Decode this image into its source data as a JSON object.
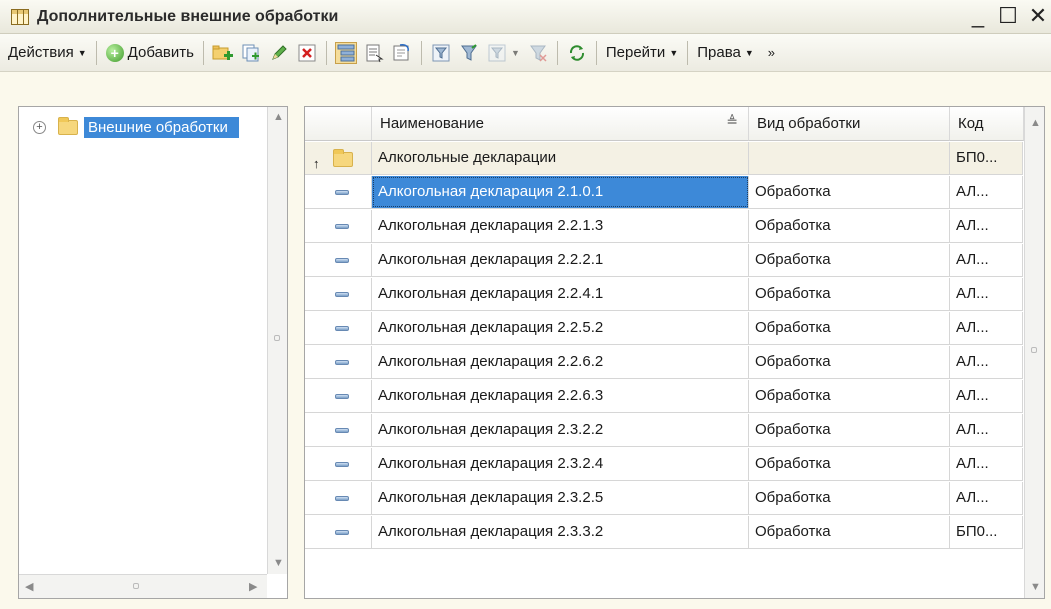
{
  "window": {
    "title": "Дополнительные внешние обработки",
    "minimize_glyph": "_",
    "maximize_glyph": "☐",
    "close_glyph": "✕"
  },
  "toolbar": {
    "actions_label": "Действия",
    "add_label": "Добавить",
    "goto_label": "Перейти",
    "rights_label": "Права",
    "overflow_glyph": "»"
  },
  "tree": {
    "root_label": "Внешние обработки"
  },
  "table": {
    "columns": [
      "Наименование",
      "Вид обработки",
      "Код"
    ],
    "group_row": {
      "name": "Алкогольные декларации",
      "type": "",
      "code": "БП0..."
    },
    "rows": [
      {
        "name": "Алкогольная декларация 2.1.0.1",
        "type": "Обработка",
        "code": "АЛ..."
      },
      {
        "name": "Алкогольная декларация 2.2.1.3",
        "type": "Обработка",
        "code": "АЛ..."
      },
      {
        "name": "Алкогольная декларация 2.2.2.1",
        "type": "Обработка",
        "code": "АЛ..."
      },
      {
        "name": "Алкогольная декларация 2.2.4.1",
        "type": "Обработка",
        "code": "АЛ..."
      },
      {
        "name": "Алкогольная декларация 2.2.5.2",
        "type": "Обработка",
        "code": "АЛ..."
      },
      {
        "name": "Алкогольная декларация 2.2.6.2",
        "type": "Обработка",
        "code": "АЛ..."
      },
      {
        "name": "Алкогольная декларация 2.2.6.3",
        "type": "Обработка",
        "code": "АЛ..."
      },
      {
        "name": "Алкогольная декларация 2.3.2.2",
        "type": "Обработка",
        "code": "АЛ..."
      },
      {
        "name": "Алкогольная декларация 2.3.2.4",
        "type": "Обработка",
        "code": "АЛ..."
      },
      {
        "name": "Алкогольная декларация 2.3.2.5",
        "type": "Обработка",
        "code": "АЛ..."
      },
      {
        "name": "Алкогольная декларация 2.3.3.2",
        "type": "Обработка",
        "code": "БП0..."
      }
    ]
  },
  "colors": {
    "selection": "#3d89d8",
    "window_bg": "#fbf9ec",
    "group_row_bg": "#f4f1e4"
  }
}
